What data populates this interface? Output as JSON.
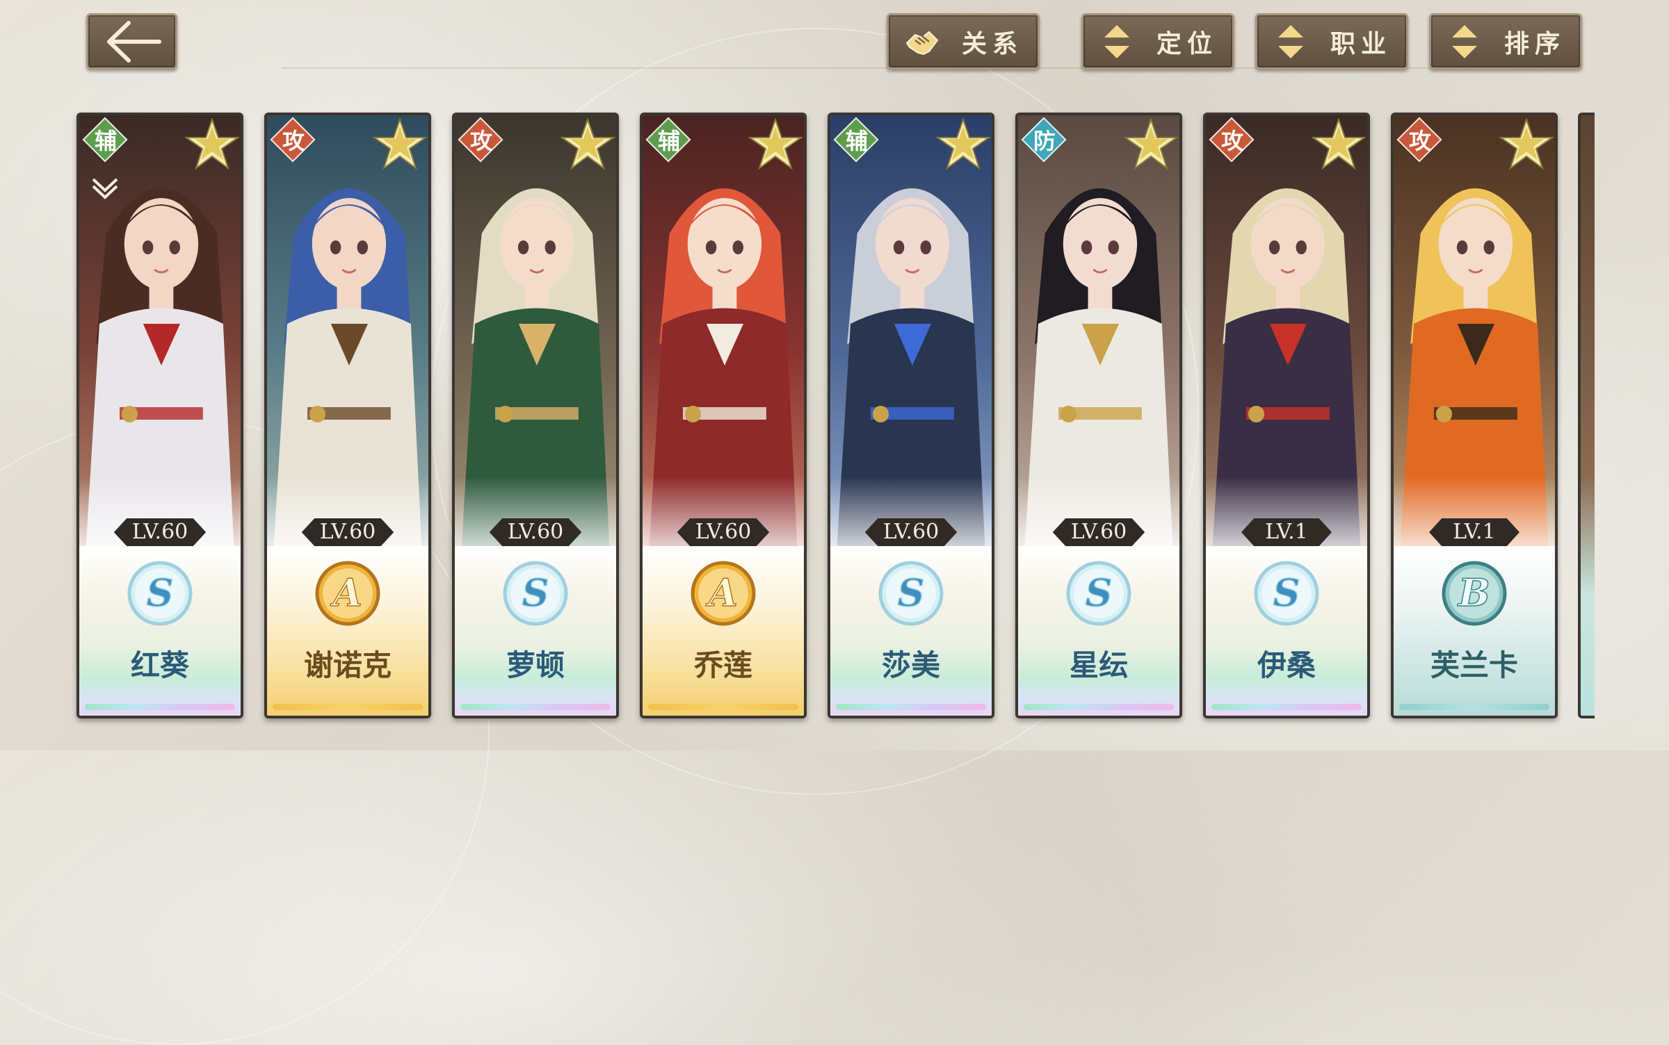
{
  "toolbar": {
    "back_icon": "back-arrow-icon",
    "filters": [
      {
        "label": "关系",
        "icon": "handshake-icon"
      },
      {
        "label": "定位",
        "icon": "sort-arrows-icon"
      },
      {
        "label": "职业",
        "icon": "sort-arrows-icon"
      },
      {
        "label": "排序",
        "icon": "sort-arrows-icon"
      }
    ]
  },
  "characters": [
    {
      "name": "红葵",
      "role": "辅",
      "level": "LV.60",
      "rank": "S",
      "locked": true
    },
    {
      "name": "谢诺克",
      "role": "攻",
      "level": "LV.60",
      "rank": "A",
      "locked": false
    },
    {
      "name": "萝顿",
      "role": "攻",
      "level": "LV.60",
      "rank": "S",
      "locked": false
    },
    {
      "name": "乔莲",
      "role": "辅",
      "level": "LV.60",
      "rank": "A",
      "locked": false
    },
    {
      "name": "莎美",
      "role": "辅",
      "level": "LV.60",
      "rank": "S",
      "locked": false
    },
    {
      "name": "星纭",
      "role": "防",
      "level": "LV.60",
      "rank": "S",
      "locked": false
    },
    {
      "name": "伊桑",
      "role": "攻",
      "level": "LV.1",
      "rank": "S",
      "locked": false
    },
    {
      "name": "芙兰卡",
      "role": "攻",
      "level": "LV.1",
      "rank": "B",
      "locked": false
    }
  ],
  "colors": {
    "role_support": "#5f9d4d",
    "role_attack": "#c9583a",
    "role_defense": "#3fa7b8",
    "name_text": "#2b5a78",
    "name_text_gold": "#6b4c1e"
  }
}
